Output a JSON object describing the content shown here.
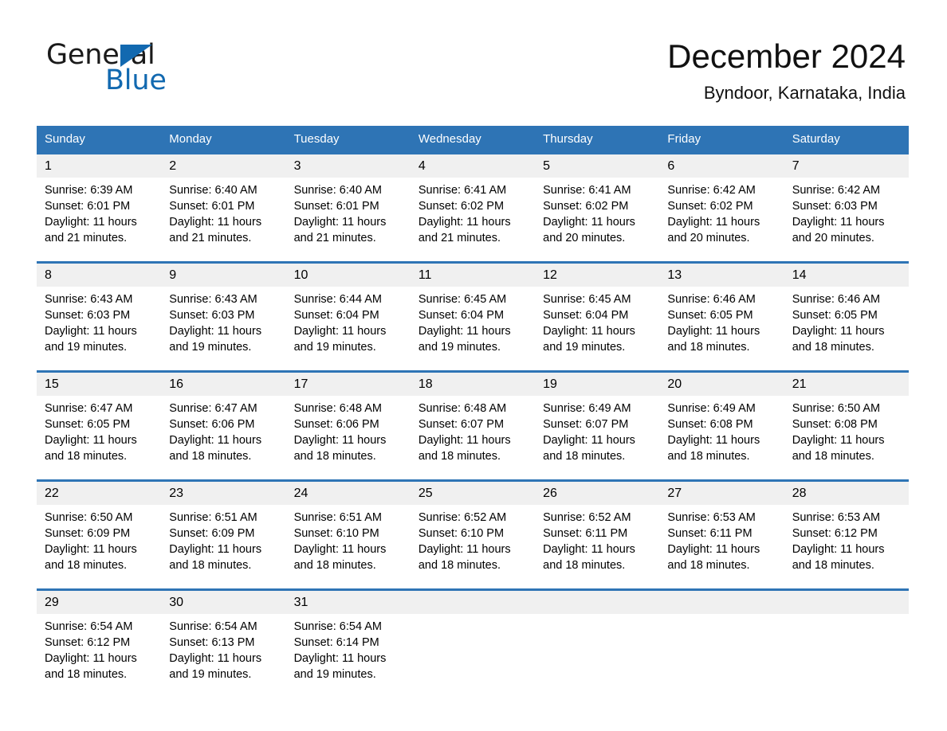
{
  "brand": {
    "name_part1": "General",
    "name_part2": "Blue",
    "triangle_color": "#1269b0"
  },
  "header": {
    "title": "December 2024",
    "subtitle": "Byndoor, Karnataka, India"
  },
  "theme": {
    "header_blue": "#2e74b5",
    "daynum_gray": "#f0f0f0",
    "page_background": "#ffffff"
  },
  "calendar": {
    "weekday_headers": [
      "Sunday",
      "Monday",
      "Tuesday",
      "Wednesday",
      "Thursday",
      "Friday",
      "Saturday"
    ],
    "weeks": [
      [
        {
          "day": "1",
          "sunrise": "Sunrise: 6:39 AM",
          "sunset": "Sunset: 6:01 PM",
          "daylight_line1": "Daylight: 11 hours",
          "daylight_line2": "and 21 minutes."
        },
        {
          "day": "2",
          "sunrise": "Sunrise: 6:40 AM",
          "sunset": "Sunset: 6:01 PM",
          "daylight_line1": "Daylight: 11 hours",
          "daylight_line2": "and 21 minutes."
        },
        {
          "day": "3",
          "sunrise": "Sunrise: 6:40 AM",
          "sunset": "Sunset: 6:01 PM",
          "daylight_line1": "Daylight: 11 hours",
          "daylight_line2": "and 21 minutes."
        },
        {
          "day": "4",
          "sunrise": "Sunrise: 6:41 AM",
          "sunset": "Sunset: 6:02 PM",
          "daylight_line1": "Daylight: 11 hours",
          "daylight_line2": "and 21 minutes."
        },
        {
          "day": "5",
          "sunrise": "Sunrise: 6:41 AM",
          "sunset": "Sunset: 6:02 PM",
          "daylight_line1": "Daylight: 11 hours",
          "daylight_line2": "and 20 minutes."
        },
        {
          "day": "6",
          "sunrise": "Sunrise: 6:42 AM",
          "sunset": "Sunset: 6:02 PM",
          "daylight_line1": "Daylight: 11 hours",
          "daylight_line2": "and 20 minutes."
        },
        {
          "day": "7",
          "sunrise": "Sunrise: 6:42 AM",
          "sunset": "Sunset: 6:03 PM",
          "daylight_line1": "Daylight: 11 hours",
          "daylight_line2": "and 20 minutes."
        }
      ],
      [
        {
          "day": "8",
          "sunrise": "Sunrise: 6:43 AM",
          "sunset": "Sunset: 6:03 PM",
          "daylight_line1": "Daylight: 11 hours",
          "daylight_line2": "and 19 minutes."
        },
        {
          "day": "9",
          "sunrise": "Sunrise: 6:43 AM",
          "sunset": "Sunset: 6:03 PM",
          "daylight_line1": "Daylight: 11 hours",
          "daylight_line2": "and 19 minutes."
        },
        {
          "day": "10",
          "sunrise": "Sunrise: 6:44 AM",
          "sunset": "Sunset: 6:04 PM",
          "daylight_line1": "Daylight: 11 hours",
          "daylight_line2": "and 19 minutes."
        },
        {
          "day": "11",
          "sunrise": "Sunrise: 6:45 AM",
          "sunset": "Sunset: 6:04 PM",
          "daylight_line1": "Daylight: 11 hours",
          "daylight_line2": "and 19 minutes."
        },
        {
          "day": "12",
          "sunrise": "Sunrise: 6:45 AM",
          "sunset": "Sunset: 6:04 PM",
          "daylight_line1": "Daylight: 11 hours",
          "daylight_line2": "and 19 minutes."
        },
        {
          "day": "13",
          "sunrise": "Sunrise: 6:46 AM",
          "sunset": "Sunset: 6:05 PM",
          "daylight_line1": "Daylight: 11 hours",
          "daylight_line2": "and 18 minutes."
        },
        {
          "day": "14",
          "sunrise": "Sunrise: 6:46 AM",
          "sunset": "Sunset: 6:05 PM",
          "daylight_line1": "Daylight: 11 hours",
          "daylight_line2": "and 18 minutes."
        }
      ],
      [
        {
          "day": "15",
          "sunrise": "Sunrise: 6:47 AM",
          "sunset": "Sunset: 6:05 PM",
          "daylight_line1": "Daylight: 11 hours",
          "daylight_line2": "and 18 minutes."
        },
        {
          "day": "16",
          "sunrise": "Sunrise: 6:47 AM",
          "sunset": "Sunset: 6:06 PM",
          "daylight_line1": "Daylight: 11 hours",
          "daylight_line2": "and 18 minutes."
        },
        {
          "day": "17",
          "sunrise": "Sunrise: 6:48 AM",
          "sunset": "Sunset: 6:06 PM",
          "daylight_line1": "Daylight: 11 hours",
          "daylight_line2": "and 18 minutes."
        },
        {
          "day": "18",
          "sunrise": "Sunrise: 6:48 AM",
          "sunset": "Sunset: 6:07 PM",
          "daylight_line1": "Daylight: 11 hours",
          "daylight_line2": "and 18 minutes."
        },
        {
          "day": "19",
          "sunrise": "Sunrise: 6:49 AM",
          "sunset": "Sunset: 6:07 PM",
          "daylight_line1": "Daylight: 11 hours",
          "daylight_line2": "and 18 minutes."
        },
        {
          "day": "20",
          "sunrise": "Sunrise: 6:49 AM",
          "sunset": "Sunset: 6:08 PM",
          "daylight_line1": "Daylight: 11 hours",
          "daylight_line2": "and 18 minutes."
        },
        {
          "day": "21",
          "sunrise": "Sunrise: 6:50 AM",
          "sunset": "Sunset: 6:08 PM",
          "daylight_line1": "Daylight: 11 hours",
          "daylight_line2": "and 18 minutes."
        }
      ],
      [
        {
          "day": "22",
          "sunrise": "Sunrise: 6:50 AM",
          "sunset": "Sunset: 6:09 PM",
          "daylight_line1": "Daylight: 11 hours",
          "daylight_line2": "and 18 minutes."
        },
        {
          "day": "23",
          "sunrise": "Sunrise: 6:51 AM",
          "sunset": "Sunset: 6:09 PM",
          "daylight_line1": "Daylight: 11 hours",
          "daylight_line2": "and 18 minutes."
        },
        {
          "day": "24",
          "sunrise": "Sunrise: 6:51 AM",
          "sunset": "Sunset: 6:10 PM",
          "daylight_line1": "Daylight: 11 hours",
          "daylight_line2": "and 18 minutes."
        },
        {
          "day": "25",
          "sunrise": "Sunrise: 6:52 AM",
          "sunset": "Sunset: 6:10 PM",
          "daylight_line1": "Daylight: 11 hours",
          "daylight_line2": "and 18 minutes."
        },
        {
          "day": "26",
          "sunrise": "Sunrise: 6:52 AM",
          "sunset": "Sunset: 6:11 PM",
          "daylight_line1": "Daylight: 11 hours",
          "daylight_line2": "and 18 minutes."
        },
        {
          "day": "27",
          "sunrise": "Sunrise: 6:53 AM",
          "sunset": "Sunset: 6:11 PM",
          "daylight_line1": "Daylight: 11 hours",
          "daylight_line2": "and 18 minutes."
        },
        {
          "day": "28",
          "sunrise": "Sunrise: 6:53 AM",
          "sunset": "Sunset: 6:12 PM",
          "daylight_line1": "Daylight: 11 hours",
          "daylight_line2": "and 18 minutes."
        }
      ],
      [
        {
          "day": "29",
          "sunrise": "Sunrise: 6:54 AM",
          "sunset": "Sunset: 6:12 PM",
          "daylight_line1": "Daylight: 11 hours",
          "daylight_line2": "and 18 minutes."
        },
        {
          "day": "30",
          "sunrise": "Sunrise: 6:54 AM",
          "sunset": "Sunset: 6:13 PM",
          "daylight_line1": "Daylight: 11 hours",
          "daylight_line2": "and 19 minutes."
        },
        {
          "day": "31",
          "sunrise": "Sunrise: 6:54 AM",
          "sunset": "Sunset: 6:14 PM",
          "daylight_line1": "Daylight: 11 hours",
          "daylight_line2": "and 19 minutes."
        },
        {
          "day": "",
          "sunrise": "",
          "sunset": "",
          "daylight_line1": "",
          "daylight_line2": ""
        },
        {
          "day": "",
          "sunrise": "",
          "sunset": "",
          "daylight_line1": "",
          "daylight_line2": ""
        },
        {
          "day": "",
          "sunrise": "",
          "sunset": "",
          "daylight_line1": "",
          "daylight_line2": ""
        },
        {
          "day": "",
          "sunrise": "",
          "sunset": "",
          "daylight_line1": "",
          "daylight_line2": ""
        }
      ]
    ]
  }
}
